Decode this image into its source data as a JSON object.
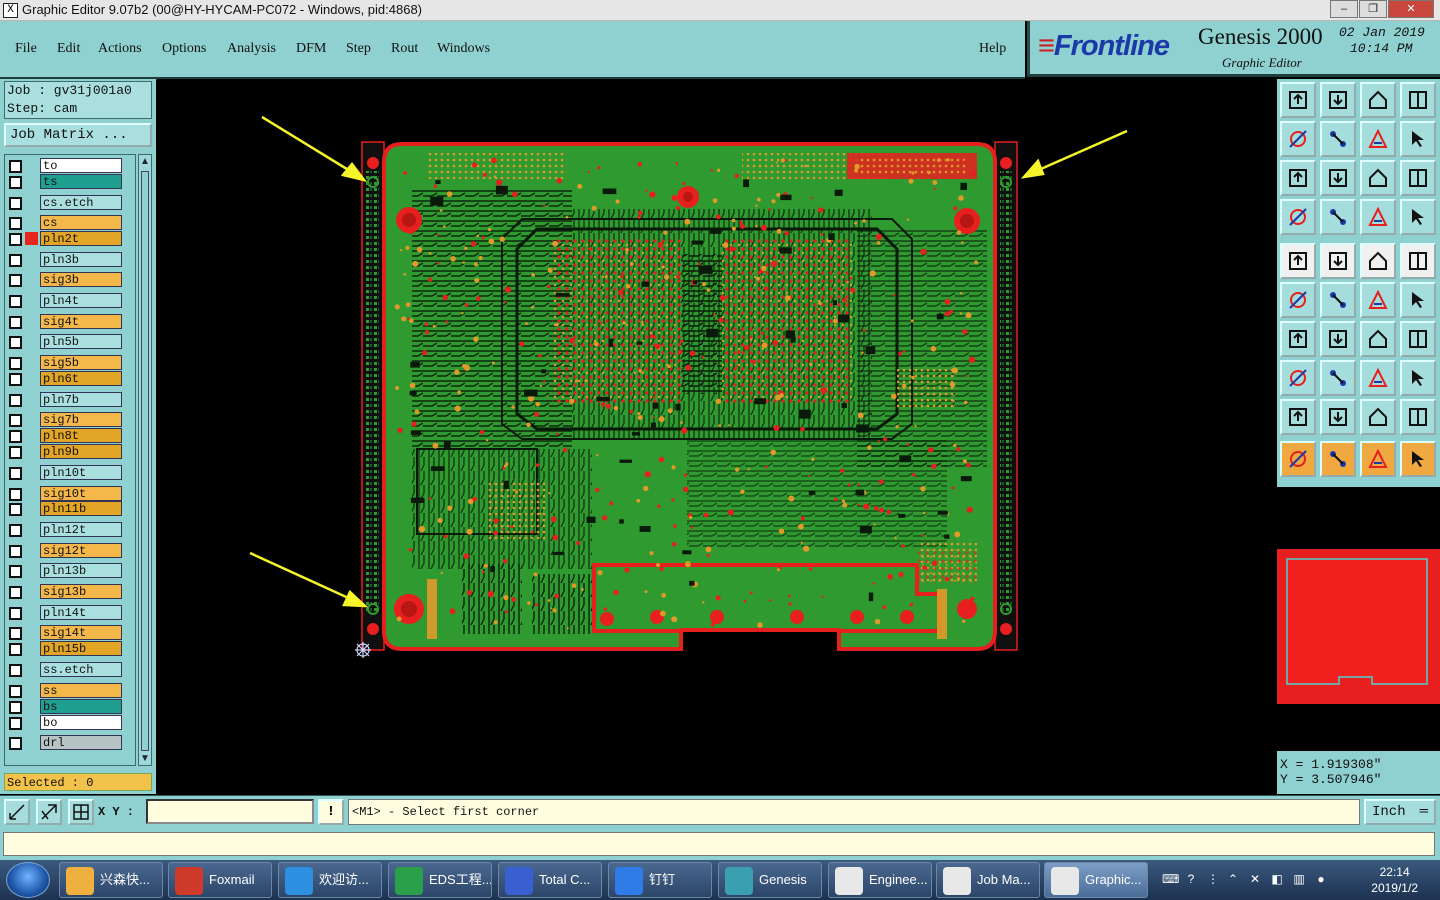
{
  "window": {
    "title": "Graphic Editor 9.07b2 (00@HY-HYCAM-PC072 - Windows, pid:4868)",
    "minimize": "–",
    "restore": "❐",
    "close": "✕"
  },
  "menu": {
    "items": [
      "File",
      "Edit",
      "Actions",
      "Options",
      "Analysis",
      "DFM",
      "Step",
      "Rout",
      "Windows"
    ],
    "help": "Help"
  },
  "brand": {
    "logo_text": "Frontline",
    "product": "Genesis 2000",
    "subtitle": "Graphic Editor",
    "date": "02 Jan 2019",
    "time": "10:14 PM"
  },
  "job": {
    "job_line": "Job : gv31j001a0",
    "step_line": "Step: cam",
    "matrix_button": "Job Matrix ..."
  },
  "layers": [
    {
      "name": "to",
      "color": "#ffffff",
      "row": 0,
      "swatch": "#1f9f8f"
    },
    {
      "name": "ts",
      "color": "#1f9f8f",
      "row": 1,
      "swatch": "#1f9f8f"
    },
    {
      "name": "cs.etch",
      "color": "#aadfdf",
      "row": 2.3,
      "swatch": "#1f9f8f"
    },
    {
      "name": "cs",
      "color": "#f3b74a",
      "row": 3.6,
      "swatch": "#2f9f4f"
    },
    {
      "name": "pln2t",
      "color": "#e2a526",
      "row": 4.6,
      "swatch": "#e8261f"
    },
    {
      "name": "pln3b",
      "color": "#aadfdf",
      "row": 5.9,
      "swatch": "#1f9f8f"
    },
    {
      "name": "sig3b",
      "color": "#f3b74a",
      "row": 7.2,
      "swatch": "#1f9f8f"
    },
    {
      "name": "pln4t",
      "color": "#aadfdf",
      "row": 8.5,
      "swatch": "#1f9f8f"
    },
    {
      "name": "sig4t",
      "color": "#f3b74a",
      "row": 9.8,
      "swatch": "#1f9f8f"
    },
    {
      "name": "pln5b",
      "color": "#aadfdf",
      "row": 11.1,
      "swatch": "#1f9f8f"
    },
    {
      "name": "sig5b",
      "color": "#f3b74a",
      "row": 12.4,
      "swatch": "#1f9f8f"
    },
    {
      "name": "pln6t",
      "color": "#e2a526",
      "row": 13.4,
      "swatch": "#1f9f8f"
    },
    {
      "name": "pln7b",
      "color": "#aadfdf",
      "row": 14.7,
      "swatch": "#1f9f8f"
    },
    {
      "name": "sig7b",
      "color": "#f3b74a",
      "row": 16.0,
      "swatch": "#1f9f8f"
    },
    {
      "name": "pln8t",
      "color": "#e2a526",
      "row": 17.0,
      "swatch": "#1f9f8f"
    },
    {
      "name": "pln9b",
      "color": "#e2a526",
      "row": 18.0,
      "swatch": "#1f9f8f"
    },
    {
      "name": "pln10t",
      "color": "#aadfdf",
      "row": 19.3,
      "swatch": "#1f9f8f"
    },
    {
      "name": "sig10t",
      "color": "#f3b74a",
      "row": 20.6,
      "swatch": "#1f9f8f"
    },
    {
      "name": "pln11b",
      "color": "#e2a526",
      "row": 21.6,
      "swatch": "#1f9f8f"
    },
    {
      "name": "pln12t",
      "color": "#aadfdf",
      "row": 22.9,
      "swatch": "#1f9f8f"
    },
    {
      "name": "sig12t",
      "color": "#f3b74a",
      "row": 24.2,
      "swatch": "#1f9f8f"
    },
    {
      "name": "pln13b",
      "color": "#aadfdf",
      "row": 25.5,
      "swatch": "#1f9f8f"
    },
    {
      "name": "sig13b",
      "color": "#f3b74a",
      "row": 26.8,
      "swatch": "#1f9f8f"
    },
    {
      "name": "pln14t",
      "color": "#aadfdf",
      "row": 28.1,
      "swatch": "#1f9f8f"
    },
    {
      "name": "sig14t",
      "color": "#f3b74a",
      "row": 29.4,
      "swatch": "#1f9f8f"
    },
    {
      "name": "pln15b",
      "color": "#e2a526",
      "row": 30.4,
      "swatch": "#1f9f8f"
    },
    {
      "name": "ss.etch",
      "color": "#aadfdf",
      "row": 31.7,
      "swatch": "#1f9f8f"
    },
    {
      "name": "ss",
      "color": "#f3b74a",
      "row": 33.0,
      "swatch": "#1f9f8f"
    },
    {
      "name": "bs",
      "color": "#1f9f8f",
      "row": 34.0,
      "swatch": "#1f9f8f"
    },
    {
      "name": "bo",
      "color": "#ffffff",
      "row": 35.0,
      "swatch": "#1f9f8f"
    },
    {
      "name": "drl",
      "color": "#b7c4c4",
      "row": 36.3,
      "swatch": "#1f9f8f"
    }
  ],
  "selected": "Selected : 0",
  "coords": {
    "x": "X  =  1.919308\"",
    "y": "Y  =  3.507946\""
  },
  "bottom": {
    "xy_label": "X Y :",
    "xy_value": "",
    "warn": "!",
    "message": "<M1> - Select first corner",
    "unit": "Inch"
  },
  "taskbar": {
    "items": [
      {
        "label": "兴森快...",
        "color": "#f0b040"
      },
      {
        "label": "Foxmail",
        "color": "#d03a2a"
      },
      {
        "label": "欢迎访...",
        "color": "#2d8fe0"
      },
      {
        "label": "EDS工程...",
        "color": "#2aa04a"
      },
      {
        "label": "Total C...",
        "color": "#3a5fd0"
      },
      {
        "label": "钉钉",
        "color": "#2f7be8"
      },
      {
        "label": "Genesis",
        "color": "#3a9fb0"
      },
      {
        "label": "Enginee...",
        "color": "#e8e8e8"
      },
      {
        "label": "Job Ma...",
        "color": "#e8e8e8"
      },
      {
        "label": "Graphic...",
        "color": "#e8e8e8"
      }
    ],
    "clock_time": "22:14",
    "clock_date": "2019/1/2"
  },
  "palette": {
    "board_green": "#2f9a2f",
    "copper_red": "#e81f1f",
    "pad_orange": "#e09a2a",
    "trace_black": "#0a1a0a",
    "arrow_yellow": "#f5f52a",
    "panel_teal": "#8fd0d0"
  }
}
